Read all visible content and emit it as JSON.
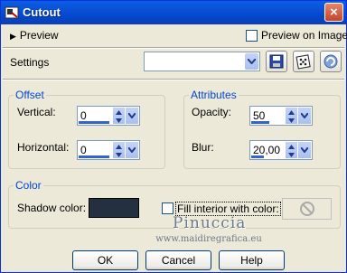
{
  "window": {
    "title": "Cutout",
    "close_label": "×"
  },
  "preview": {
    "expander_label": "Preview",
    "preview_on_image_label": "Preview on Image",
    "preview_on_image_checked": false
  },
  "settings": {
    "label": "Settings",
    "preset_value": "",
    "tools": [
      "save-preset-icon",
      "randomize-dice-icon",
      "reset-icon"
    ]
  },
  "offset": {
    "title": "Offset",
    "vertical_label": "Vertical:",
    "vertical_value": "0",
    "horizontal_label": "Horizontal:",
    "horizontal_value": "0"
  },
  "attributes": {
    "title": "Attributes",
    "opacity_label": "Opacity:",
    "opacity_value": "50",
    "blur_label": "Blur:",
    "blur_value": "20,00"
  },
  "color": {
    "title": "Color",
    "shadow_color_label": "Shadow color:",
    "shadow_color": "#243040",
    "fill_interior_label": "Fill interior with color:",
    "fill_interior_checked": false
  },
  "watermark": {
    "name": "Pinuccia",
    "url": "www.maidiregrafica.eu"
  },
  "buttons": {
    "ok": "OK",
    "cancel": "Cancel",
    "help": "Help"
  }
}
